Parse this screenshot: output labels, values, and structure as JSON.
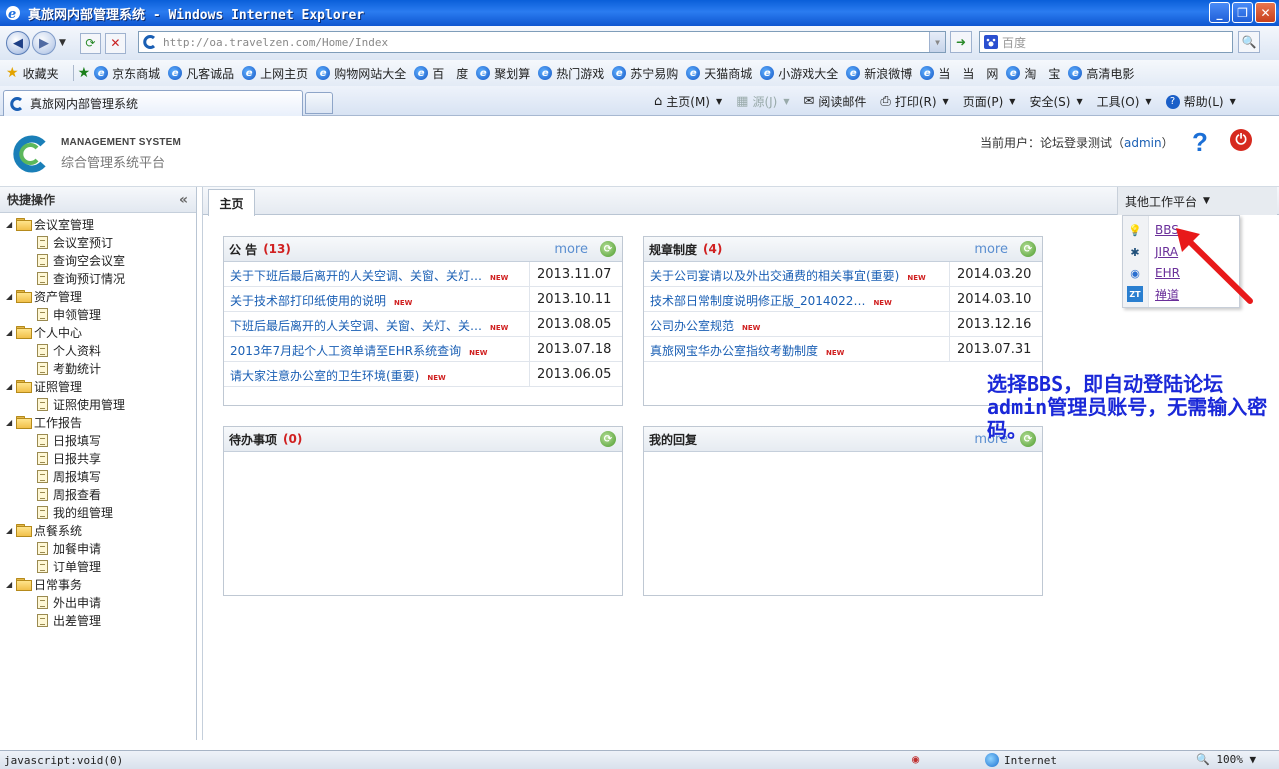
{
  "window": {
    "title": "真旅网内部管理系统 - Windows Internet Explorer"
  },
  "browser": {
    "url": "http://oa.travelzen.com/Home/Index",
    "search_placeholder": "百度",
    "favorites_label": "收藏夹",
    "favorites": [
      "京东商城",
      "凡客诚品",
      "上网主页",
      "购物网站大全",
      "百　度",
      "聚划算",
      "热门游戏",
      "苏宁易购",
      "天猫商城",
      "小游戏大全",
      "新浪微博",
      "当　当　网",
      "淘　宝",
      "高清电影"
    ],
    "tab_title": "真旅网内部管理系统",
    "commands": [
      {
        "icon": "home-icon",
        "label": "主页(M)",
        "dropdown": true,
        "disabled": false
      },
      {
        "icon": "feeds-icon",
        "label": "源(J)",
        "dropdown": true,
        "disabled": true
      },
      {
        "icon": "mail-icon",
        "label": "阅读邮件",
        "dropdown": false,
        "disabled": false
      },
      {
        "icon": "print-icon",
        "label": "打印(R)",
        "dropdown": true,
        "disabled": false
      },
      {
        "icon": "page-icon",
        "label": "页面(P)",
        "dropdown": true,
        "disabled": false
      },
      {
        "icon": "safety-icon",
        "label": "安全(S)",
        "dropdown": true,
        "disabled": false
      },
      {
        "icon": "tools-icon",
        "label": "工具(O)",
        "dropdown": true,
        "disabled": false
      },
      {
        "icon": "help-icon",
        "label": "帮助(L)",
        "dropdown": true,
        "disabled": false
      }
    ],
    "status_text": "javascript:void(0)",
    "zone": "Internet",
    "zoom": "100%"
  },
  "app": {
    "logo_en": "MANAGEMENT SYSTEM",
    "logo_cn": "综合管理系统平台",
    "user_prefix": "当前用户：论坛登录测试（",
    "user_id": "admin",
    "user_suffix": "）"
  },
  "sidebar": {
    "title": "快捷操作",
    "groups": [
      {
        "label": "会议室管理",
        "children": [
          "会议室预订",
          "查询空会议室",
          "查询预订情况"
        ]
      },
      {
        "label": "资产管理",
        "children": [
          "申领管理"
        ]
      },
      {
        "label": "个人中心",
        "children": [
          "个人资料",
          "考勤统计"
        ]
      },
      {
        "label": "证照管理",
        "children": [
          "证照使用管理"
        ]
      },
      {
        "label": "工作报告",
        "children": [
          "日报填写",
          "日报共享",
          "周报填写",
          "周报查看",
          "我的组管理"
        ]
      },
      {
        "label": "点餐系统",
        "children": [
          "加餐申请",
          "订单管理"
        ]
      },
      {
        "label": "日常事务",
        "children": [
          "外出申请",
          "出差管理"
        ]
      }
    ]
  },
  "main": {
    "home_tab": "主页",
    "other_platform": "其他工作平台",
    "platform_menu": [
      {
        "label": "BBS",
        "icon": "lightbulb-icon"
      },
      {
        "label": "JIRA",
        "icon": "jira-icon"
      },
      {
        "label": "EHR",
        "icon": "ehr-icon"
      },
      {
        "label": "禅道",
        "icon": "zentao-icon"
      }
    ],
    "announcements": {
      "title": "公 告",
      "count": "(13)",
      "more": "more",
      "rows": [
        {
          "title": "关于下班后最后离开的人关空调、关窗、关灯…",
          "new": "NEW",
          "date": "2013.11.07"
        },
        {
          "title": "关于技术部打印纸使用的说明",
          "new": "NEW",
          "date": "2013.10.11"
        },
        {
          "title": "下班后最后离开的人关空调、关窗、关灯、关…",
          "new": "NEW",
          "date": "2013.08.05"
        },
        {
          "title": "2013年7月起个人工资单请至EHR系统查询",
          "new": "NEW",
          "date": "2013.07.18"
        },
        {
          "title": "请大家注意办公室的卫生环境(重要)",
          "new": "NEW",
          "date": "2013.06.05"
        }
      ]
    },
    "regulations": {
      "title": "规章制度",
      "count": "(4)",
      "more": "more",
      "rows": [
        {
          "title": "关于公司宴请以及外出交通费的相关事宜(重要)",
          "new": "NEW",
          "date": "2014.03.20"
        },
        {
          "title": "技术部日常制度说明修正版_2014022…",
          "new": "NEW",
          "date": "2014.03.10"
        },
        {
          "title": "公司办公室规范",
          "new": "NEW",
          "date": "2013.12.16"
        },
        {
          "title": "真旅网宝华办公室指纹考勤制度",
          "new": "NEW",
          "date": "2013.07.31"
        }
      ]
    },
    "todo": {
      "title": "待办事项",
      "count": "(0)"
    },
    "replies": {
      "title": "我的回复",
      "more": "more"
    },
    "annotation": "选择BBS，即自动登陆论坛admin管理员账号，无需输入密码。"
  }
}
